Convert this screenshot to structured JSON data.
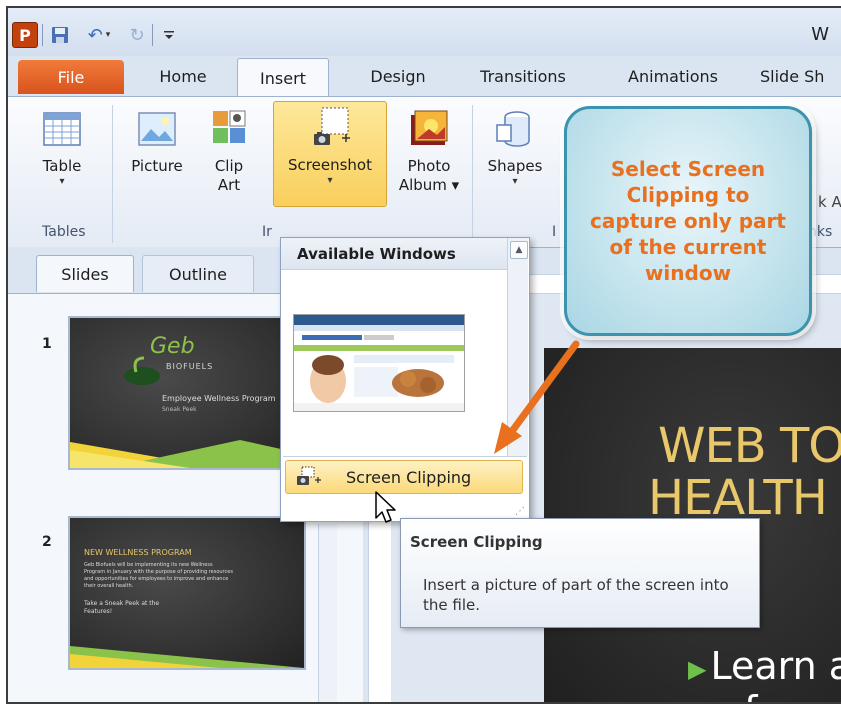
{
  "window": {
    "title_fragment": "W"
  },
  "quick_access": {
    "app_icon": "P"
  },
  "tabs": {
    "file": "File",
    "home": "Home",
    "insert": "Insert",
    "design": "Design",
    "transitions": "Transitions",
    "animations": "Animations",
    "slideshow": "Slide Sh"
  },
  "ribbon": {
    "table": "Table",
    "picture": "Picture",
    "clip_line1": "Clip",
    "clip_line2": "Art",
    "screenshot": "Screenshot",
    "photo_line1": "Photo",
    "photo_line2": "Album ▾",
    "shapes": "Shapes",
    "group_tables": "Tables",
    "group_images_fragment": "Ir",
    "group_illustrations_fragment": "I",
    "group_links_fragment": "nks",
    "partial_label": "k A"
  },
  "slides_panel": {
    "tab_slides": "Slides",
    "tab_outline": "Outline",
    "slide1_number": "1",
    "slide2_number": "2",
    "slide1": {
      "logo": "Geb",
      "logo_sub": "BIOFUELS",
      "subtitle": "Employee Wellness Program",
      "sub2": "Sneak Peek"
    },
    "slide2": {
      "title": "NEW WELLNESS PROGRAM",
      "body": "Geb Biofuels will be implementing its new Wellness Program in January with the purpose of providing resources and opportunities for employees to improve and enhance their overall health.",
      "body2": "Take a Sneak Peek at the Features!"
    }
  },
  "main_slide": {
    "title_line1": "WEB TO",
    "title_line2": "HEALTH",
    "bullet": "Learn a",
    "bullet2": "f"
  },
  "dropdown": {
    "header": "Available Windows",
    "screen_clipping": "Screen Clipping"
  },
  "tooltip": {
    "title": "Screen Clipping",
    "description": "Insert a picture of part of the screen into the file."
  },
  "callout": {
    "text": "Select Screen Clipping to capture only part of the current window"
  },
  "colors": {
    "callout_text": "#e8701f",
    "arrow": "#e8701f",
    "file_tab": "#d9531e",
    "slide_title": "#e8c86a"
  }
}
